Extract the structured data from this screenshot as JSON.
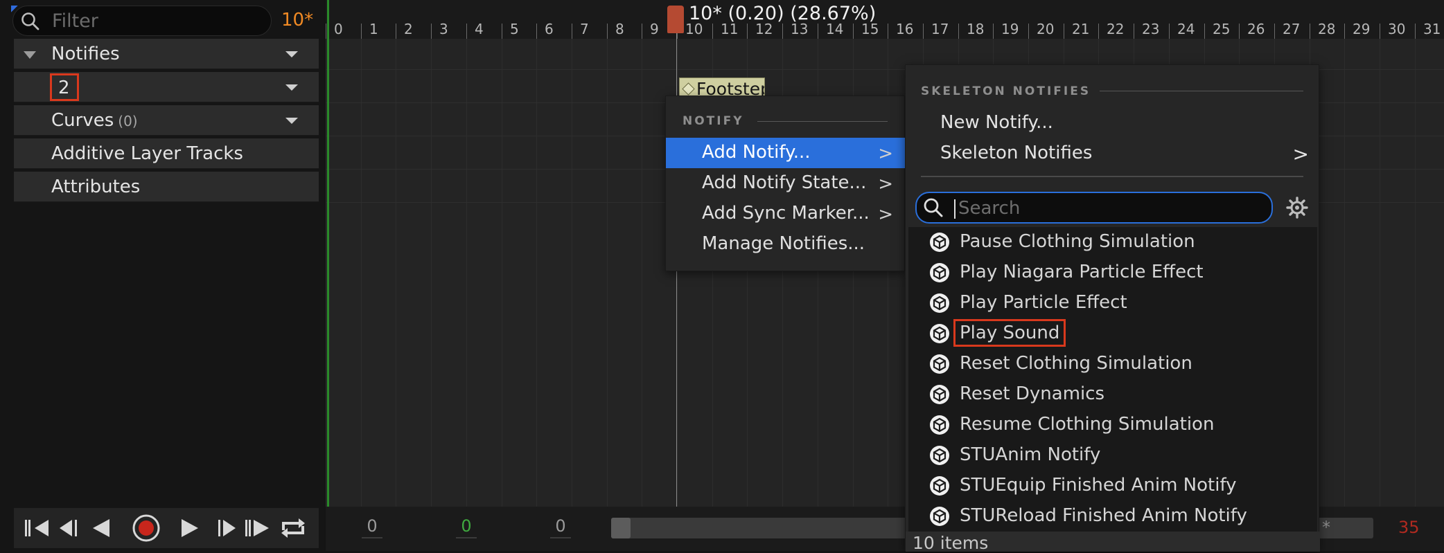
{
  "left_panel": {
    "filter_placeholder": "Filter",
    "frame_indicator": "10*",
    "tracks": [
      {
        "label": "Notifies"
      },
      {
        "label": "2"
      },
      {
        "label": "Curves",
        "count": "(0)"
      },
      {
        "label": "Additive Layer Tracks"
      },
      {
        "label": "Attributes"
      }
    ]
  },
  "timeline": {
    "frames": [
      "0",
      "1",
      "2",
      "3",
      "4",
      "5",
      "6",
      "7",
      "8",
      "9",
      "10",
      "11",
      "12",
      "13",
      "14",
      "15",
      "16",
      "17",
      "18",
      "19",
      "20",
      "21",
      "22",
      "23",
      "24",
      "25",
      "26",
      "27",
      "28",
      "29",
      "30",
      "31"
    ],
    "playhead_label": "10* (0.20) (28.67%)",
    "notify_event": "Footstep",
    "bottom_numbers": [
      "0",
      "0",
      "0"
    ],
    "bottom_colors": [
      "#9a9a9a",
      "#3fa93f",
      "#9a9a9a"
    ],
    "bottom_right_asterisk": "*",
    "bottom_right_end": "35"
  },
  "notify_menu": {
    "heading": "NOTIFY",
    "items": [
      {
        "label": "Add Notify...",
        "has_submenu": true,
        "selected": true
      },
      {
        "label": "Add Notify State...",
        "has_submenu": true
      },
      {
        "label": "Add Sync Marker...",
        "has_submenu": true
      },
      {
        "label": "Manage Notifies...",
        "has_submenu": false
      }
    ]
  },
  "skeleton_menu": {
    "heading": "SKELETON NOTIFIES",
    "items": [
      {
        "label": "New Notify...",
        "has_submenu": false
      },
      {
        "label": "Skeleton Notifies",
        "has_submenu": true
      }
    ],
    "search_placeholder": "Search",
    "list": [
      "Pause Clothing Simulation",
      "Play Niagara Particle Effect",
      "Play Particle Effect",
      "Play Sound",
      "Reset Clothing Simulation",
      "Reset Dynamics",
      "Resume Clothing Simulation",
      "STUAnim Notify",
      "STUEquip Finished Anim Notify",
      "STUReload Finished Anim Notify"
    ],
    "highlighted_item": "Play Sound",
    "footer": "10 items"
  },
  "colors": {
    "accent": "#2a6fdb",
    "highlight_outline": "#d9391d",
    "frame_indicator": "#f08a24"
  }
}
